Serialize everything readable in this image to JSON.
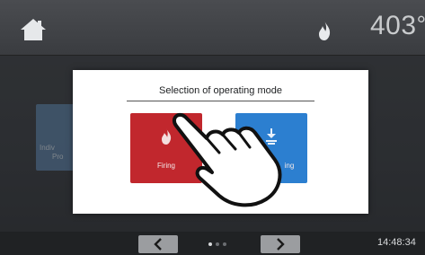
{
  "topbar": {
    "home_icon": "home-icon",
    "status_icon": "flame-icon",
    "temperature_value": "403",
    "temperature_unit": "°"
  },
  "background": {
    "tile_text_line1": "Indiv",
    "tile_text_line2": "Pro"
  },
  "modal": {
    "title": "Selection of operating mode",
    "buttons": [
      {
        "label": "Firing",
        "icon": "flame-icon",
        "color": "#c1272d"
      },
      {
        "label": "ing",
        "icon": "press-icon",
        "color": "#2c7fd0"
      }
    ]
  },
  "bottombar": {
    "prev_icon": "chevron-left-icon",
    "next_icon": "chevron-right-icon",
    "page_dots": 3,
    "active_dot": 1,
    "clock": "14:48:34"
  },
  "colors": {
    "topbar": "#3a3c40",
    "modal_bg": "#ffffff",
    "firing": "#c1272d",
    "press": "#2c7fd0"
  }
}
